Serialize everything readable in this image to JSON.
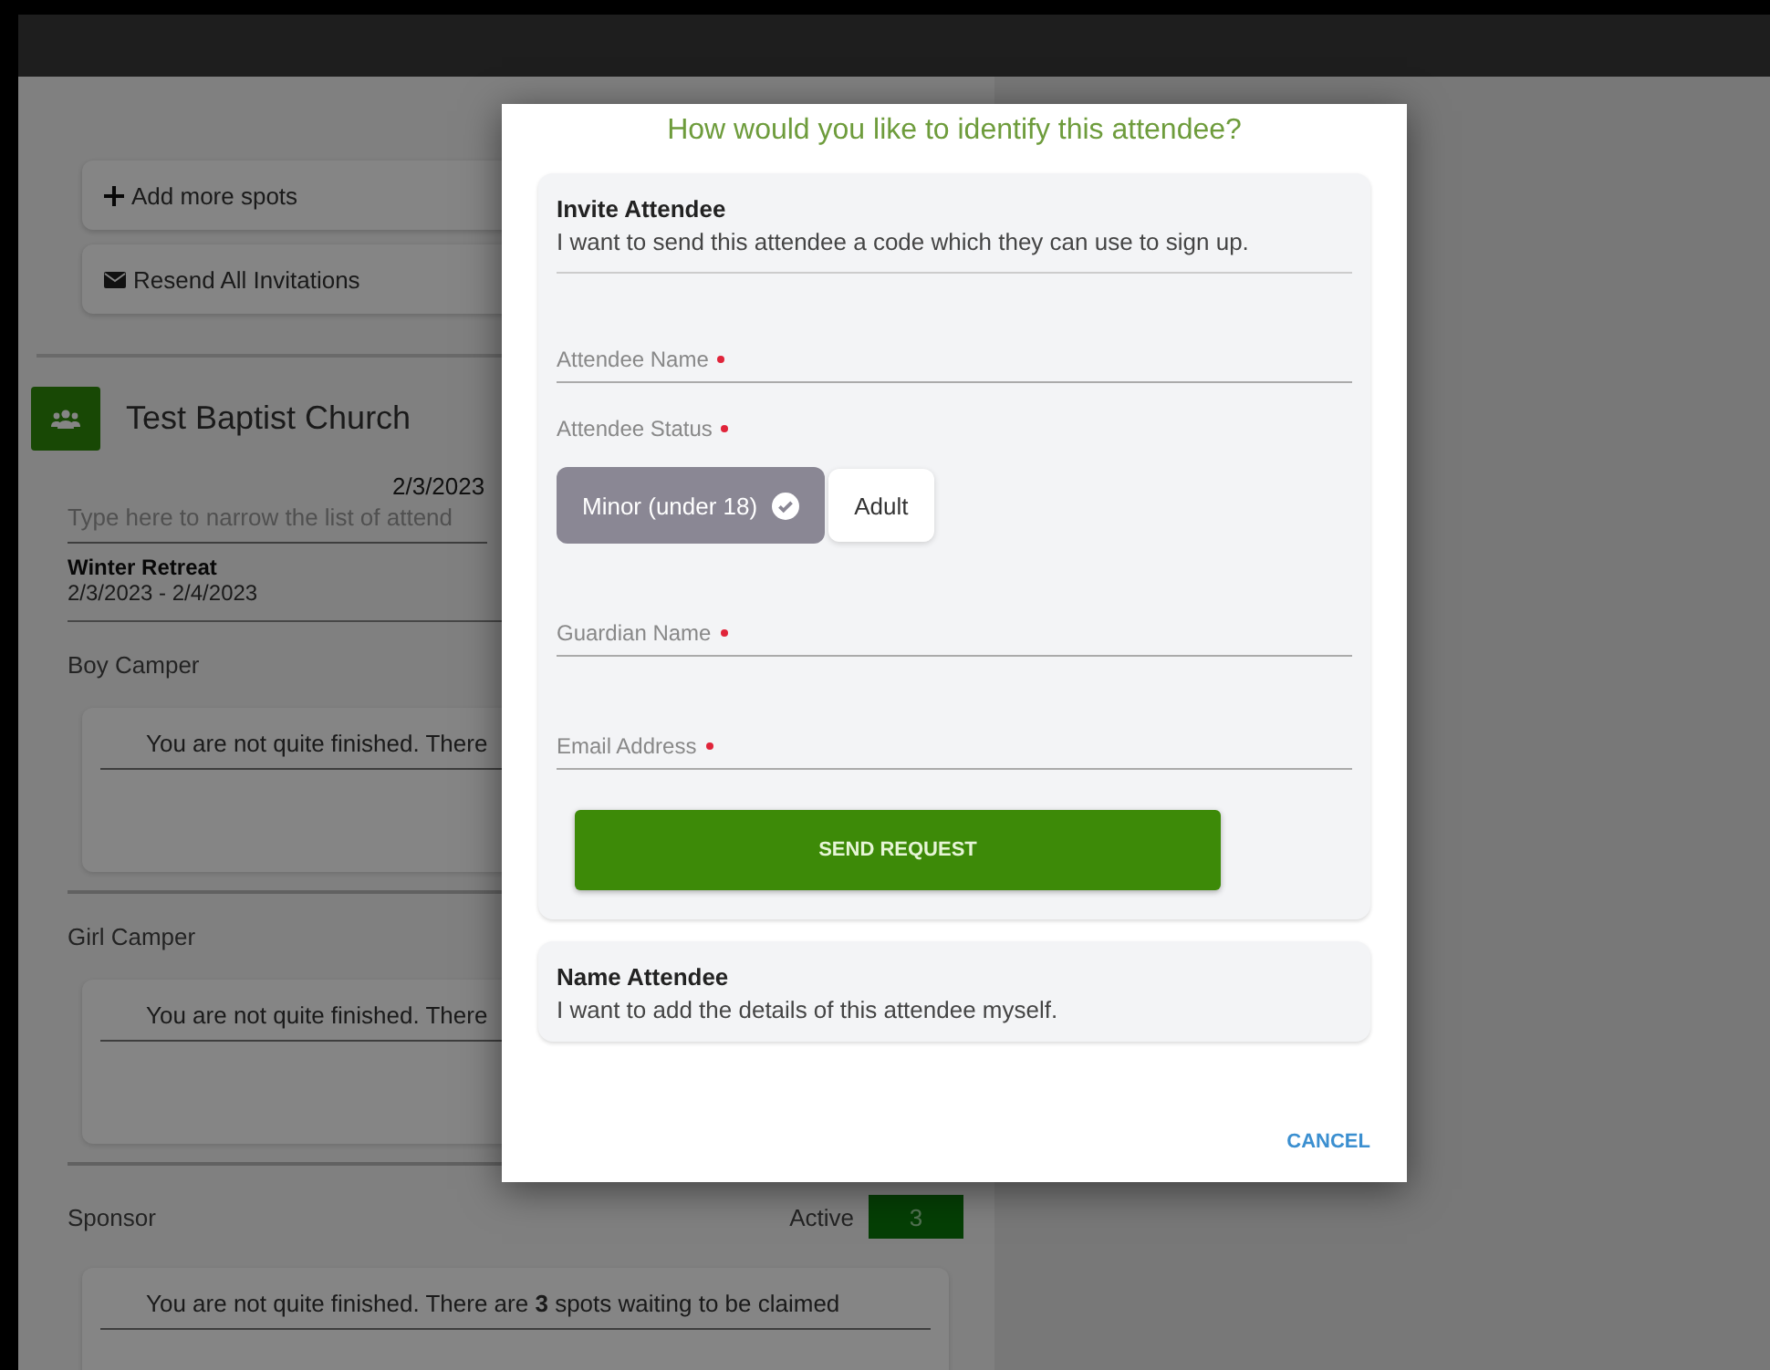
{
  "sidebar": {
    "actions": [
      {
        "kind": "add",
        "label": "Add more spots"
      },
      {
        "kind": "resend",
        "label": "Resend All Invitations"
      }
    ]
  },
  "group": {
    "name": "Test Baptist Church",
    "date": "2/3/2023"
  },
  "search": {
    "placeholder": "Type here to narrow the list of attend"
  },
  "event": {
    "name": "Winter Retreat",
    "dates": "2/3/2023 - 2/4/2023"
  },
  "roles": [
    {
      "name": "Boy Camper",
      "notice": "You are not quite finished. There"
    },
    {
      "name": "Girl Camper",
      "notice": "You are not quite finished. There"
    },
    {
      "name": "Sponsor",
      "status": "Active",
      "count": "3",
      "notice": "You are not quite finished. There are **3** spots waiting to be claimed"
    }
  ],
  "dialog": {
    "title": "How would you like to identify this attendee?",
    "options": [
      {
        "title": "Invite Attendee",
        "description": "I want to send this attendee a code which they can use to sign up.",
        "expanded": true,
        "fields": [
          {
            "kind": "text",
            "label": "Attendee Name",
            "required": true
          },
          {
            "kind": "toggle",
            "label": "Attendee Status",
            "required": true,
            "choices": [
              {
                "label": "Minor (under 18)",
                "selected": true
              },
              {
                "label": "Adult",
                "selected": false
              }
            ]
          },
          {
            "kind": "text",
            "label": "Guardian Name",
            "required": true
          },
          {
            "kind": "text",
            "label": "Email Address",
            "required": true
          }
        ],
        "submit": "SEND REQUEST"
      },
      {
        "title": "Name Attendee",
        "description": "I want to add the details of this attendee myself.",
        "expanded": false
      }
    ],
    "cancel": "CANCEL"
  }
}
